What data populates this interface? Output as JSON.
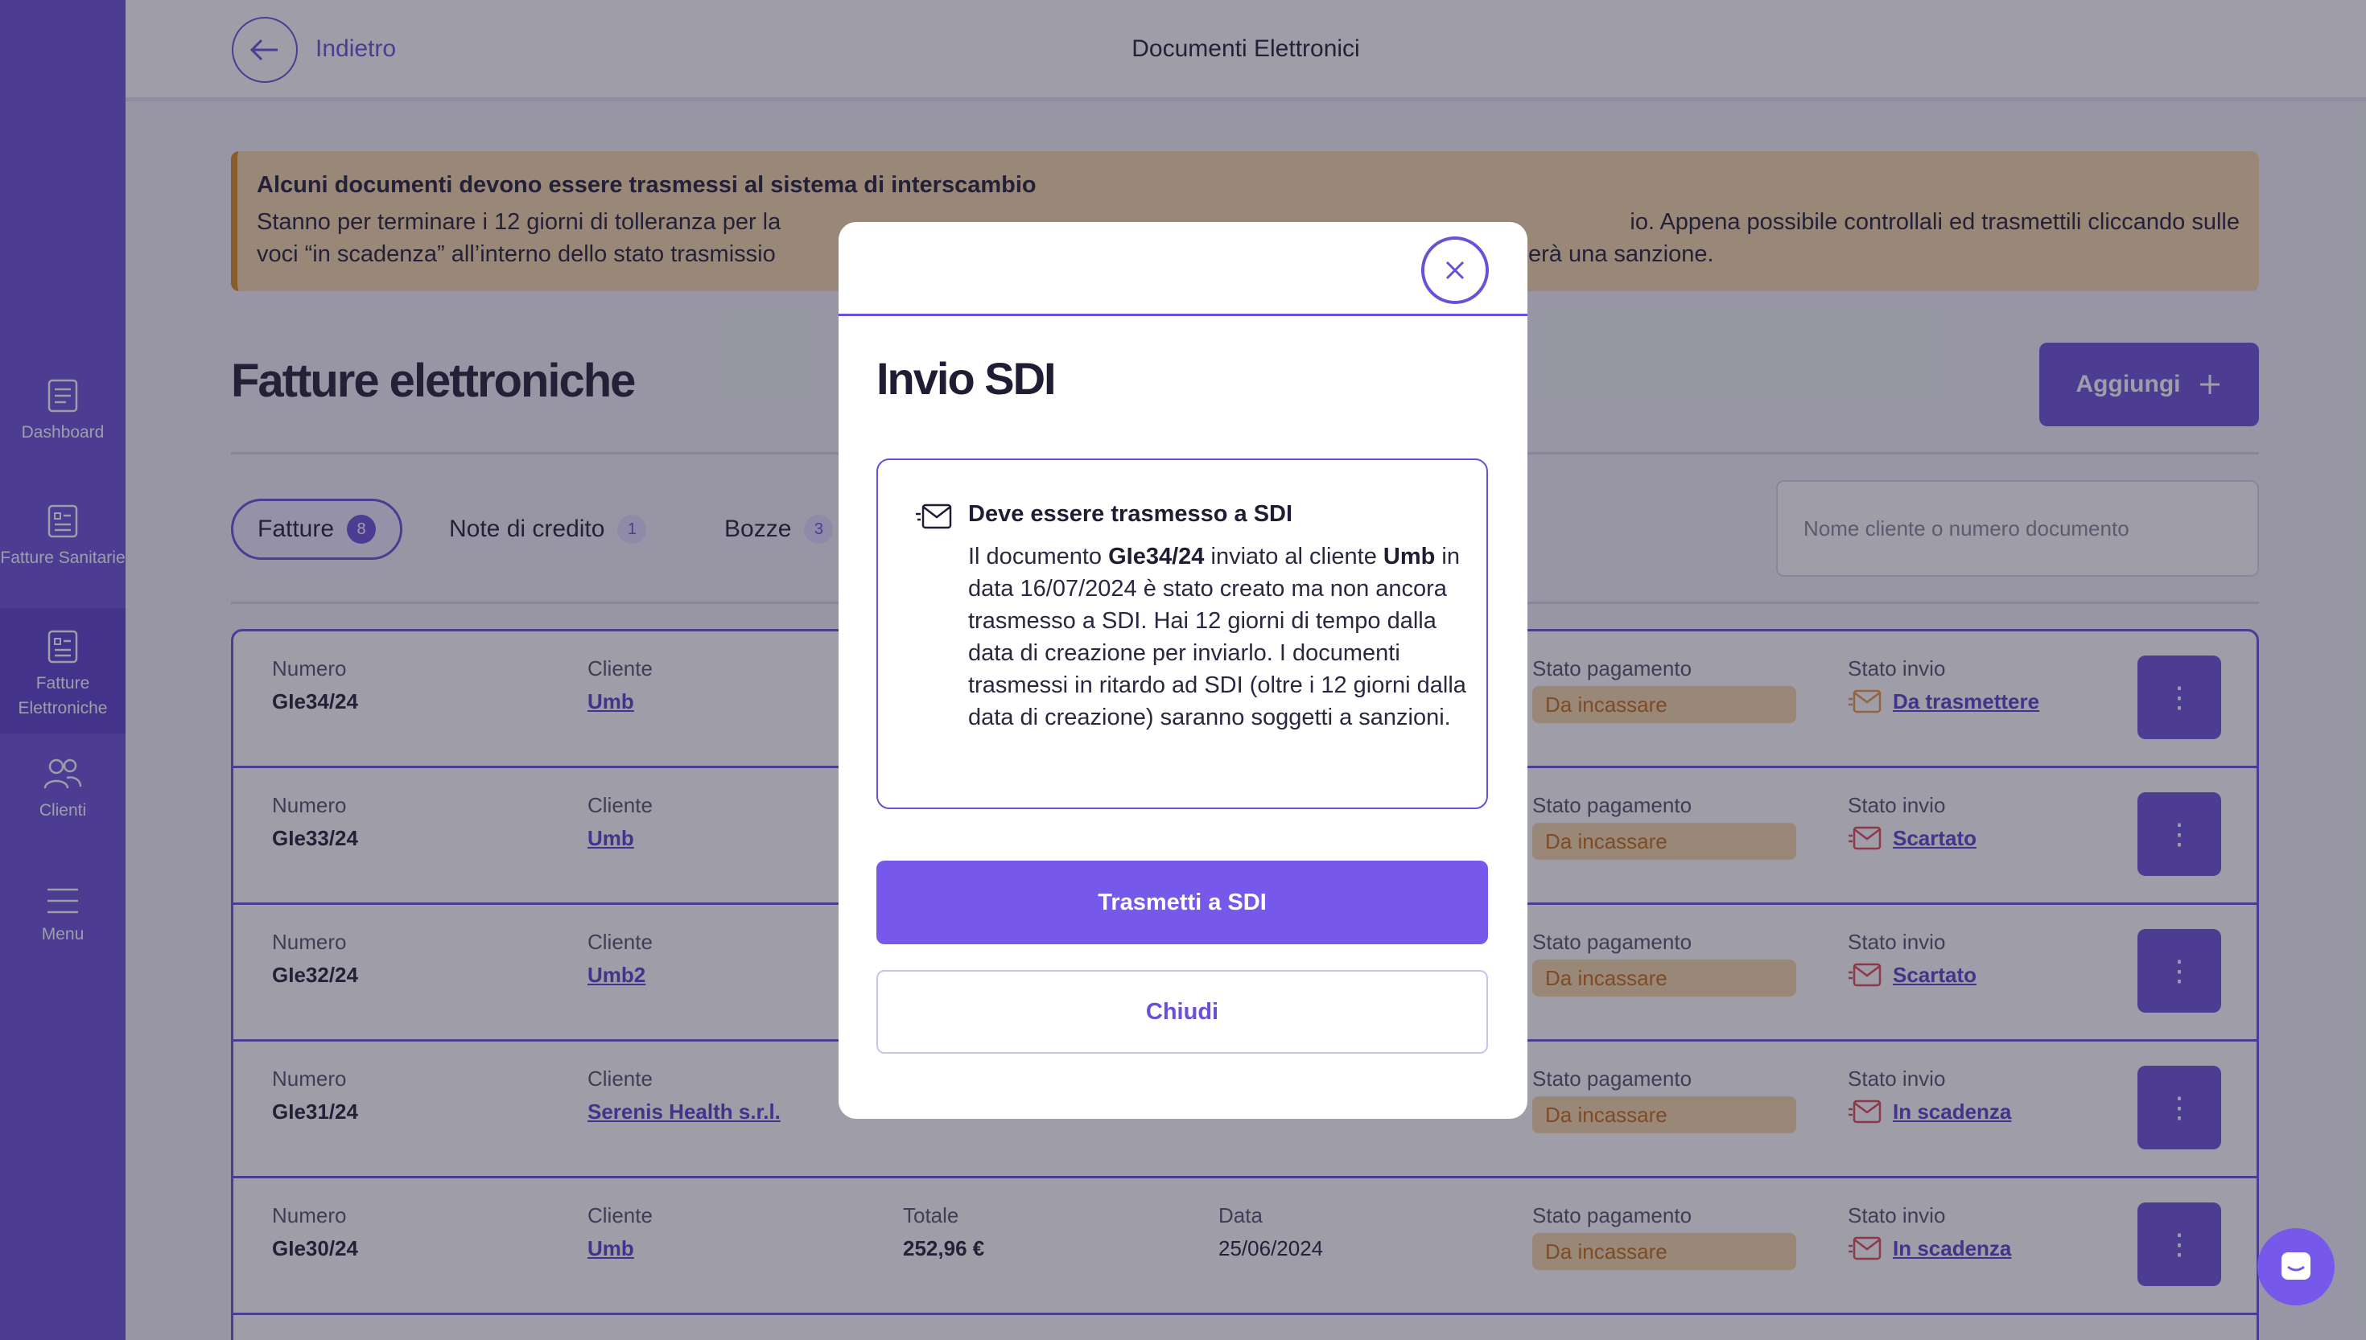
{
  "header": {
    "back_label": "Indietro",
    "title": "Documenti Elettronici"
  },
  "sidebar": {
    "items": [
      {
        "label": "Dashboard",
        "icon": "dashboard-icon"
      },
      {
        "label": "Fatture Sanitarie",
        "icon": "invoice-icon"
      },
      {
        "label": "Fatture Elettroniche",
        "icon": "invoice-icon",
        "active": true
      },
      {
        "label": "Clienti",
        "icon": "users-icon"
      },
      {
        "label": "Menu",
        "icon": "menu-icon"
      }
    ]
  },
  "alert": {
    "title": "Alcuni documenti devono essere trasmessi al sistema di interscambio",
    "text_line1_left": "Stanno per terminare i 12 giorni di tolleranza per la",
    "text_line1_right": "io. Appena possibile controllali ed trasmettili cliccando sulle",
    "text_line2_left": "voci “in scadenza” all’interno dello stato trasmissio",
    "text_line2_right": "erà una sanzione."
  },
  "main": {
    "title": "Fatture elettroniche",
    "add_label": "Aggiungi",
    "tabs": [
      {
        "label": "Fatture",
        "count": "8"
      },
      {
        "label": "Note di credito",
        "count": "1"
      },
      {
        "label": "Bozze",
        "count": "3"
      }
    ],
    "search_placeholder": "Nome cliente o numero documento"
  },
  "table": {
    "headers": {
      "numero": "Numero",
      "cliente": "Cliente",
      "totale": "Totale",
      "data": "Data",
      "stato_pagamento": "Stato pagamento",
      "stato_invio": "Stato invio"
    },
    "rows": [
      {
        "numero": "GIe34/24",
        "cliente": "Umb",
        "totale": "",
        "data": "",
        "pagamento": "Da incassare",
        "invio": "Da trasmettere"
      },
      {
        "numero": "GIe33/24",
        "cliente": "Umb",
        "totale": "",
        "data": "",
        "pagamento": "Da incassare",
        "invio": "Scartato"
      },
      {
        "numero": "GIe32/24",
        "cliente": "Umb2",
        "totale": "",
        "data": "",
        "pagamento": "Da incassare",
        "invio": "Scartato"
      },
      {
        "numero": "GIe31/24",
        "cliente": "Serenis Health s.r.l.",
        "totale": "",
        "data": "",
        "pagamento": "Da incassare",
        "invio": "In scadenza"
      },
      {
        "numero": "GIe30/24",
        "cliente": "Umb",
        "totale": "252,96 €",
        "data": "25/06/2024",
        "pagamento": "Da incassare",
        "invio": "In scadenza"
      }
    ]
  },
  "modal": {
    "title": "Invio SDI",
    "info_title": "Deve essere trasmesso a SDI",
    "text_1": "Il documento ",
    "doc_number": "GIe34/24",
    "text_2": " inviato al cliente ",
    "client": "Umb",
    "text_3": " in data 16/07/2024 è stato creato ma non ancora trasmesso a SDI. Hai 12 giorni di tempo dalla data di creazione per inviarlo. I documenti trasmessi in ritardo ad SDI (oltre i 12 giorni dalla data di creazione) saranno soggetti a sanzioni.",
    "primary_label": "Trasmetti a SDI",
    "secondary_label": "Chiudi"
  },
  "colors": {
    "accent": "#6a4fd8",
    "warning_bg": "#f6d9a6",
    "warning_text": "#c16a14",
    "status_red": "#e0484d",
    "status_orange": "#e89a3c"
  }
}
